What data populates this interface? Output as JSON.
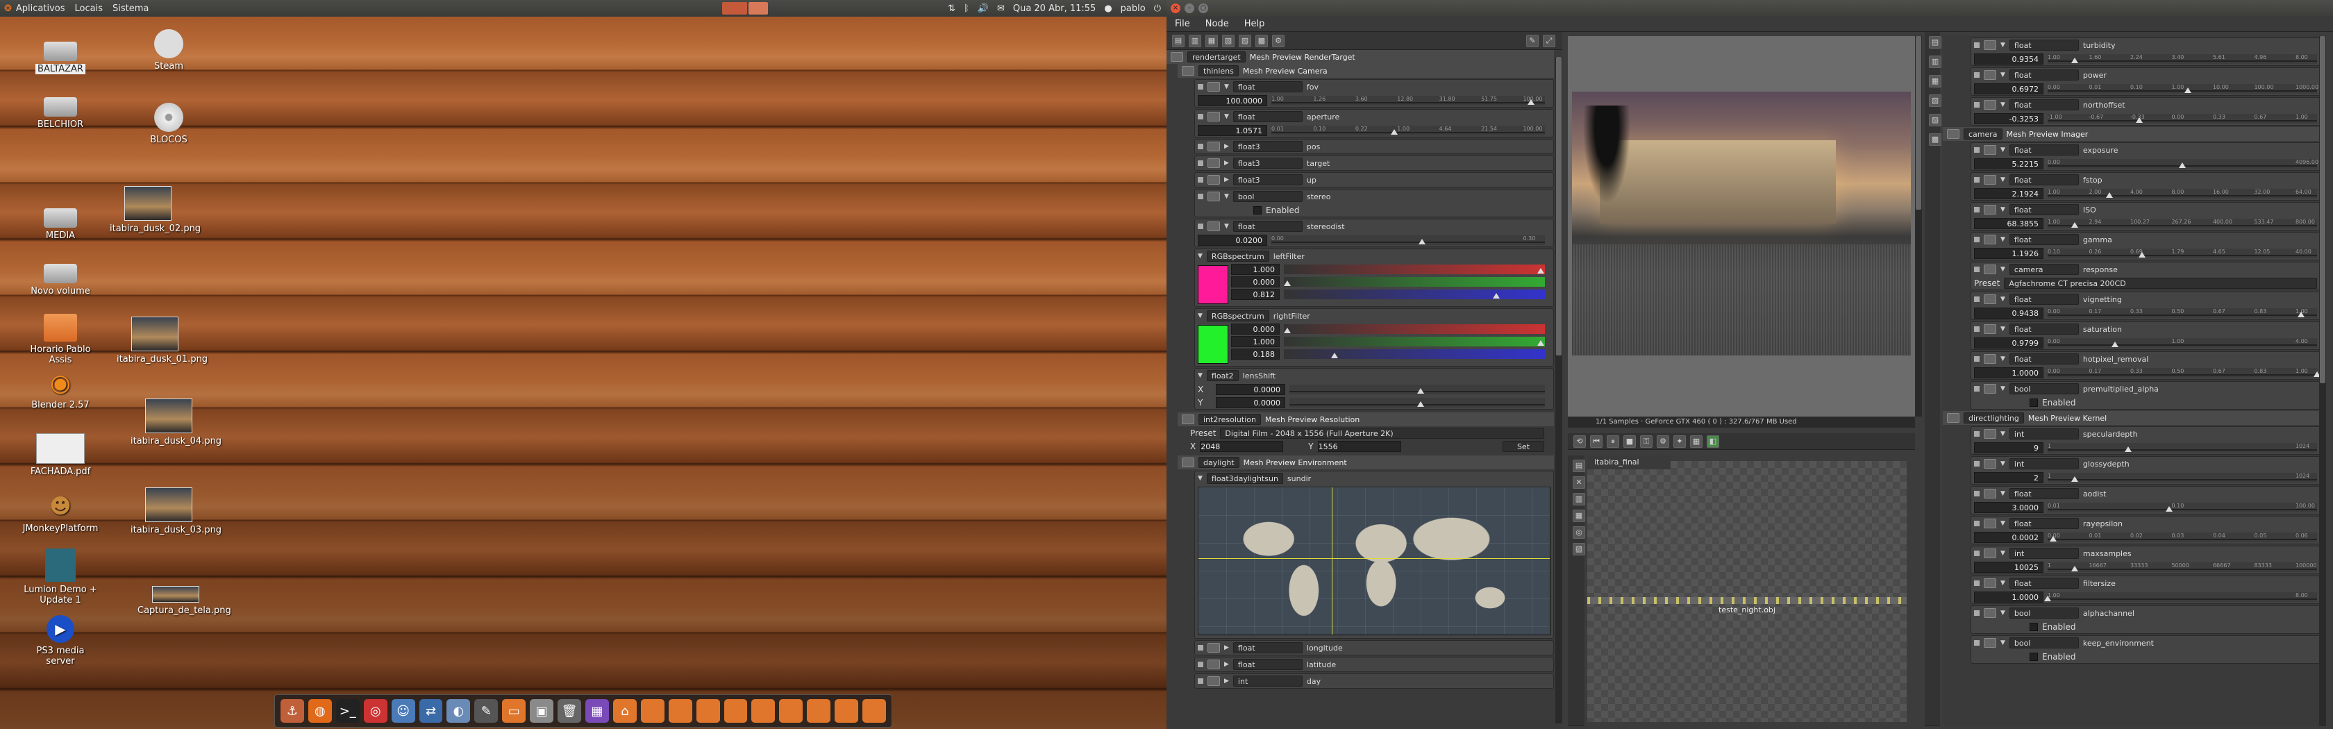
{
  "topbar": {
    "menus": [
      "Aplicativos",
      "Locais",
      "Sistema"
    ],
    "clock": "Qua 20 Abr, 11:55",
    "user": "pablo"
  },
  "desktop_icons": [
    {
      "label": "BALTAZAR",
      "type": "hdd"
    },
    {
      "label": "BELCHIOR",
      "type": "hdd"
    },
    {
      "label": "MEDIA",
      "type": "hdd"
    },
    {
      "label": "Novo volume",
      "type": "hdd"
    },
    {
      "label": "Horario Pablo Assis",
      "type": "folder"
    },
    {
      "label": "Blender 2.57",
      "type": "app"
    },
    {
      "label": "FACHADA.pdf",
      "type": "pdf"
    },
    {
      "label": "JMonkeyPlatform",
      "type": "app"
    },
    {
      "label": "Lumion Demo + Update 1",
      "type": "app"
    },
    {
      "label": "PS3 media server",
      "type": "app"
    },
    {
      "label": "Steam",
      "type": "app"
    },
    {
      "label": "BLOCOS",
      "type": "disc"
    },
    {
      "label": "itabira_dusk_02.png",
      "type": "image"
    },
    {
      "label": "itabira_dusk_01.png",
      "type": "image"
    },
    {
      "label": "itabira_dusk_04.png",
      "type": "image"
    },
    {
      "label": "itabira_dusk_03.png",
      "type": "image"
    },
    {
      "label": "Captura_de_tela.png",
      "type": "image"
    }
  ],
  "app": {
    "menus": [
      "File",
      "Node",
      "Help"
    ],
    "rendertarget_node": {
      "type": "rendertarget",
      "name": "Mesh Preview RenderTarget"
    },
    "camera_node": {
      "type": "thinlens",
      "name": "Mesh Preview Camera"
    },
    "camera_params": [
      {
        "type": "float",
        "name": "fov",
        "value": "100.0000",
        "ticks": [
          "1.00",
          "1.26",
          "3.60",
          "12.80",
          "31.80",
          "51.75",
          "100.00"
        ],
        "pos": 0.95
      },
      {
        "type": "float",
        "name": "aperture",
        "value": "1.0571",
        "ticks": [
          "0.01",
          "0.10",
          "0.22",
          "1.00",
          "4.64",
          "21.54",
          "100.00"
        ],
        "pos": 0.45
      },
      {
        "type": "float3",
        "name": "pos"
      },
      {
        "type": "float3",
        "name": "target"
      },
      {
        "type": "float3",
        "name": "up"
      },
      {
        "type": "bool",
        "name": "stereo",
        "value": "Enabled"
      },
      {
        "type": "float",
        "name": "stereodist",
        "value": "0.0200",
        "ticks": [
          "0.00",
          "",
          "",
          "",
          "",
          "",
          "0.30"
        ],
        "pos": 0.55
      }
    ],
    "leftFilter": {
      "type": "RGBspectrum",
      "name": "leftFilter",
      "values": [
        "1.000",
        "0.000",
        "0.812"
      ],
      "color": "#ff1a9a"
    },
    "rightFilter": {
      "type": "RGBspectrum",
      "name": "rightFilter",
      "values": [
        "0.000",
        "1.000",
        "0.188"
      ],
      "color": "#22f02a"
    },
    "lensShift": {
      "type": "float2",
      "name": "lensShift",
      "values": [
        "0.0000",
        "0.0000"
      ],
      "axes": [
        "X",
        "Y"
      ]
    },
    "resolution_node": {
      "type": "int2resolution",
      "name": "Mesh Preview Resolution",
      "preset_label": "Preset",
      "preset": "Digital Film - 2048 x 1556 (Full Aperture 2K)",
      "x": "2048",
      "y": "1556",
      "set": "Set",
      "x_label": "X",
      "y_label": "Y"
    },
    "environment_node": {
      "type": "daylight",
      "name": "Mesh Preview Environment",
      "sun_type": "float3daylightsun",
      "sun_name": "sundir"
    },
    "env_params": [
      {
        "type": "float",
        "name": "longitude"
      },
      {
        "type": "float",
        "name": "latitude"
      },
      {
        "type": "int",
        "name": "day"
      }
    ],
    "viewport_status": "1/1 Samples · GeForce GTX 460 ( 0 ) : 327.6/767 MB Used",
    "material_tab": "itabira_final",
    "mesh_node": "teste_night.obj",
    "right_params_top": [
      {
        "type": "float",
        "name": "turbidity",
        "value": "0.9354",
        "ticks": [
          "1.00",
          "1.60",
          "2.24",
          "3.40",
          "5.61",
          "4.96",
          "8.00"
        ],
        "pos": 0.1
      },
      {
        "type": "float",
        "name": "power",
        "value": "0.6972",
        "ticks": [
          "0.00",
          "0.01",
          "0.10",
          "1.00",
          "10.00",
          "100.00",
          "1000.00"
        ],
        "pos": 0.52
      },
      {
        "type": "float",
        "name": "northoffset",
        "value": "-0.3253",
        "ticks": [
          "-1.00",
          "-0.67",
          "-0.33",
          "0.00",
          "0.33",
          "0.67",
          "1.00"
        ],
        "pos": 0.34
      }
    ],
    "imager_node": {
      "type": "camera",
      "name": "Mesh Preview Imager"
    },
    "imager_params": [
      {
        "type": "float",
        "name": "exposure",
        "value": "5.2215",
        "ticks": [
          "0.00",
          "",
          "",
          "",
          "",
          "",
          "4096.00"
        ],
        "pos": 0.5
      },
      {
        "type": "float",
        "name": "fstop",
        "value": "2.1924",
        "ticks": [
          "1.00",
          "2.00",
          "4.00",
          "8.00",
          "16.00",
          "32.00",
          "64.00"
        ],
        "pos": 0.23
      },
      {
        "type": "float",
        "name": "ISO",
        "value": "68.3855",
        "ticks": [
          "1.00",
          "2.94",
          "100.27",
          "267.26",
          "400.00",
          "533.47",
          "800.00"
        ],
        "pos": 0.1
      },
      {
        "type": "float",
        "name": "gamma",
        "value": "1.1926",
        "ticks": [
          "0.10",
          "0.26",
          "0.69",
          "1.79",
          "4.65",
          "12.05",
          "40.00"
        ],
        "pos": 0.35
      },
      {
        "type": "camera response",
        "name": "response",
        "preset_label": "Preset",
        "preset": "Agfachrome CT precisa 200CD"
      },
      {
        "type": "float",
        "name": "vignetting",
        "value": "0.9438",
        "ticks": [
          "0.00",
          "0.17",
          "0.33",
          "0.50",
          "0.67",
          "0.83",
          "1.00"
        ],
        "pos": 0.94
      },
      {
        "type": "float",
        "name": "saturation",
        "value": "0.9799",
        "ticks": [
          "0.00",
          "",
          "",
          "1.00",
          "",
          "",
          "4.00"
        ],
        "pos": 0.25
      },
      {
        "type": "float",
        "name": "hotpixel_removal",
        "value": "1.0000",
        "ticks": [
          "0.00",
          "0.17",
          "0.33",
          "0.50",
          "0.67",
          "0.83",
          "1.00"
        ],
        "pos": 1.0
      },
      {
        "type": "bool",
        "name": "premultiplied_alpha",
        "value": "Enabled"
      }
    ],
    "kernel_node": {
      "type": "directlighting",
      "name": "Mesh Preview Kernel"
    },
    "kernel_params": [
      {
        "type": "int",
        "name": "speculardepth",
        "value": "9",
        "ticks": [
          "1",
          "",
          "",
          "",
          "",
          "",
          "1024"
        ],
        "pos": 0.3
      },
      {
        "type": "int",
        "name": "glossydepth",
        "value": "2",
        "ticks": [
          "1",
          "",
          "",
          "",
          "",
          "",
          "1024"
        ],
        "pos": 0.1
      },
      {
        "type": "float",
        "name": "aodist",
        "value": "3.0000",
        "ticks": [
          "0.01",
          "",
          "",
          "0.10",
          "",
          "",
          "100.00"
        ],
        "pos": 0.45
      },
      {
        "type": "float",
        "name": "rayepsilon",
        "value": "0.0002",
        "ticks": [
          "0.00",
          "0.01",
          "0.02",
          "0.03",
          "0.04",
          "0.05",
          "0.06"
        ],
        "pos": 0.02
      },
      {
        "type": "int",
        "name": "maxsamples",
        "value": "10025",
        "ticks": [
          "1",
          "16667",
          "33333",
          "50000",
          "66667",
          "83333",
          "100000"
        ],
        "pos": 0.1
      },
      {
        "type": "float",
        "name": "filtersize",
        "value": "1.0000",
        "ticks": [
          "1.00",
          "",
          "",
          "",
          "",
          "",
          "8.00"
        ],
        "pos": 0.0
      },
      {
        "type": "bool",
        "name": "alphachannel",
        "value": "Enabled"
      },
      {
        "type": "bool",
        "name": "keep_environment",
        "value": "Enabled"
      }
    ]
  }
}
